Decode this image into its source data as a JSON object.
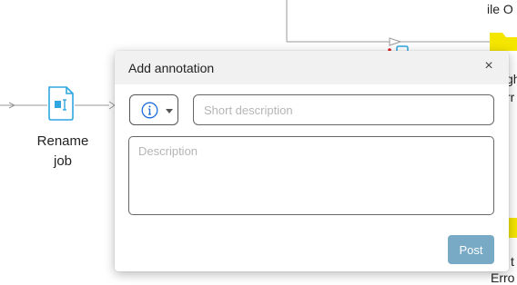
{
  "canvas": {
    "node_label_line1": "Rename",
    "node_label_line2": "job",
    "top_right_text": "ile O",
    "right_text_1": "gh",
    "right_text_2": "rr",
    "bottom_right_text_1": "t",
    "bottom_right_text_2": "Erro"
  },
  "dialog": {
    "title": "Add annotation",
    "close_icon": "close-icon",
    "type_icon": "info-icon",
    "short_placeholder": "Short description",
    "short_value": "",
    "description_placeholder": "Description",
    "description_value": "",
    "post_label": "Post"
  },
  "colors": {
    "accent": "#2fa6e0",
    "post_button": "#78a9c5",
    "yellow_node": "#f5e600",
    "header_bg": "#f1f1f1"
  }
}
